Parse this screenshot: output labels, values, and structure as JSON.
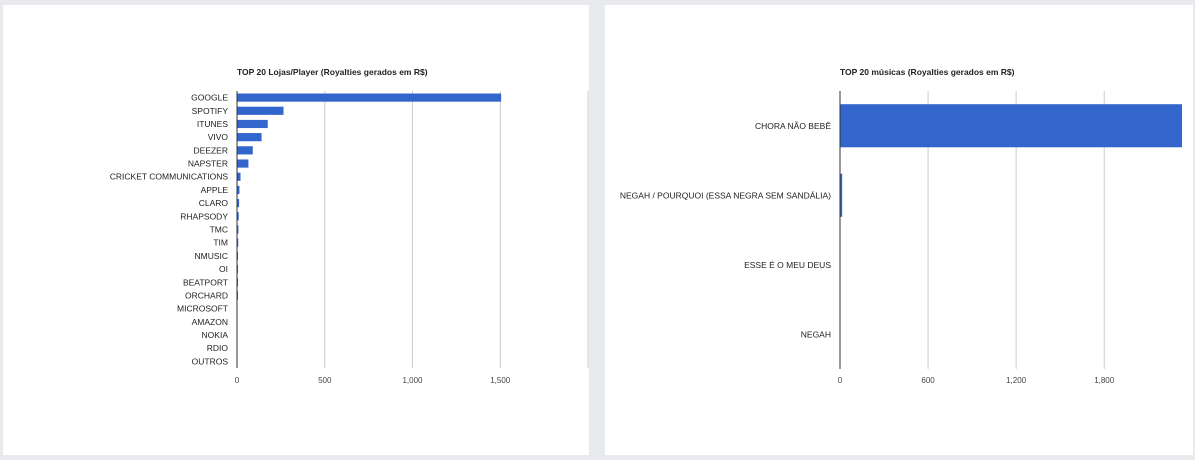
{
  "colors": {
    "bar": "#3366cc",
    "grid": "#cccccc",
    "axis": "#333333"
  },
  "chart_data": [
    {
      "type": "bar",
      "orientation": "horizontal",
      "title": "TOP 20 Lojas/Player (Royalties gerados em R$)",
      "categories": [
        "GOOGLE",
        "SPOTIFY",
        "ITUNES",
        "VIVO",
        "DEEZER",
        "NAPSTER",
        "CRICKET COMMUNICATIONS",
        "APPLE",
        "CLARO",
        "RHAPSODY",
        "TMC",
        "TIM",
        "NMUSIC",
        "OI",
        "BEATPORT",
        "ORCHARD",
        "MICROSOFT",
        "AMAZON",
        "NOKIA",
        "RDIO",
        "OUTROS"
      ],
      "values": [
        1505,
        265,
        175,
        140,
        90,
        65,
        20,
        14,
        12,
        10,
        8,
        7,
        5,
        3,
        2,
        2,
        1,
        1,
        1,
        1,
        1
      ],
      "xticks": [
        "0",
        "500",
        "1,000",
        "1,500"
      ],
      "xlim": [
        0,
        2000
      ],
      "grid": true
    },
    {
      "type": "bar",
      "orientation": "horizontal",
      "title": "TOP 20 músicas (Royalties gerados em R$)",
      "categories": [
        "CHORA NÃO BEBÊ",
        "NEGAH / POURQUOI (ESSA NEGRA SEM SANDÁLIA)",
        "ESSE É O MEU DEUS",
        "NEGAH"
      ],
      "values": [
        2330,
        15,
        0,
        0
      ],
      "xticks": [
        "0",
        "600",
        "1,200",
        "1,800"
      ],
      "xlim": [
        0,
        2330
      ],
      "grid": true
    }
  ]
}
